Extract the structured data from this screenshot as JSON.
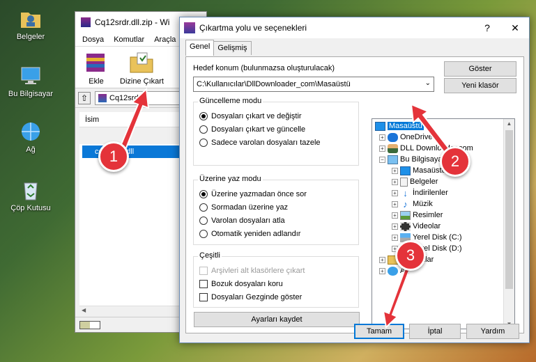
{
  "desktop": {
    "icons": [
      {
        "label": "Belgeler",
        "icon": "folder-user-icon"
      },
      {
        "label": "Bu Bilgisayar",
        "icon": "computer-icon"
      },
      {
        "label": "Ağ",
        "icon": "network-icon"
      },
      {
        "label": "Çöp Kutusu",
        "icon": "recycle-bin-icon"
      }
    ]
  },
  "rar": {
    "title": "Cq12srdr.dll.zip - Wi",
    "menu": [
      "Dosya",
      "Komutlar",
      "Araçla"
    ],
    "tools": {
      "add": "Ekle",
      "extract": "Dizine Çıkart"
    },
    "path": "Cq12srdr.d",
    "column_name": "İsim",
    "file": "cq12srdr.dll"
  },
  "dialog": {
    "title": "Çıkartma yolu ve seçenekleri",
    "help": "?",
    "close": "✕",
    "tabs": {
      "general": "Genel",
      "advanced": "Gelişmiş"
    },
    "dest_label": "Hedef konum (bulunmazsa oluşturulacak)",
    "dest_value": "C:\\Kullanıcılar\\DllDownloader_com\\Masaüstü",
    "show_btn": "Göster",
    "new_folder_btn": "Yeni klasör",
    "update_mode": {
      "title": "Güncelleme modu",
      "options": [
        "Dosyaları çıkart ve değiştir",
        "Dosyaları çıkart ve güncelle",
        "Sadece varolan dosyaları tazele"
      ]
    },
    "overwrite_mode": {
      "title": "Üzerine yaz modu",
      "options": [
        "Üzerine yazmadan önce sor",
        "Sormadan üzerine yaz",
        "Varolan dosyaları atla",
        "Otomatik yeniden adlandır"
      ]
    },
    "misc": {
      "title": "Çeşitli",
      "options": [
        "Arşivleri alt klasörlere çıkart",
        "Bozuk dosyaları koru",
        "Dosyaları Gezginde göster"
      ]
    },
    "save_btn": "Ayarları kaydet",
    "tree": {
      "root": "Masaüstü",
      "onedrive": "OneDrive",
      "user": "DLL Downloader.com",
      "pc": "Bu Bilgisayar",
      "desktop": "Masaüstü",
      "documents": "Belgeler",
      "downloads": "İndirilenler",
      "music": "Müzik",
      "pictures": "Resimler",
      "videos": "Videolar",
      "disk_c": "Yerel Disk (C:)",
      "disk_d": "Yerel Disk (D:)",
      "libraries": "Kitaplıklar",
      "network": "Ağ"
    },
    "ok_btn": "Tamam",
    "cancel_btn": "İptal",
    "help_btn": "Yardım"
  },
  "annotations": {
    "step1": "1",
    "step2": "2",
    "step3": "3",
    "color": "#e4333a"
  }
}
